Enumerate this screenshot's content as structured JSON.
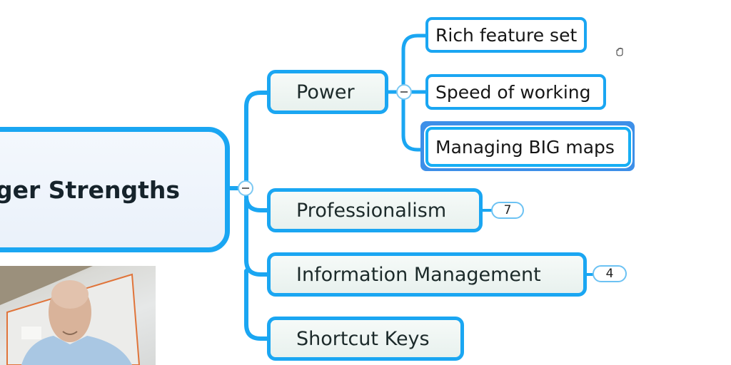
{
  "central_topic": {
    "label": "ger Strengths"
  },
  "main_topics": [
    {
      "label": "Power",
      "collapsed": false
    },
    {
      "label": "Professionalism",
      "child_count": "7"
    },
    {
      "label": "Information Management",
      "child_count": "4"
    },
    {
      "label": "Shortcut Keys"
    }
  ],
  "power_subtopics": [
    {
      "label": "Rich feature set"
    },
    {
      "label": "Speed of working"
    },
    {
      "label": "Managing BIG maps",
      "selected": true
    }
  ],
  "colors": {
    "connector": "#1aa6f2",
    "selection": "#3d8fe8",
    "central_bg": "#eef4fb",
    "topic_bg": "#eef4f1"
  },
  "overlay": {
    "webcam": "presenter-video"
  },
  "cursor": {
    "type": "hand-pan-cursor"
  }
}
